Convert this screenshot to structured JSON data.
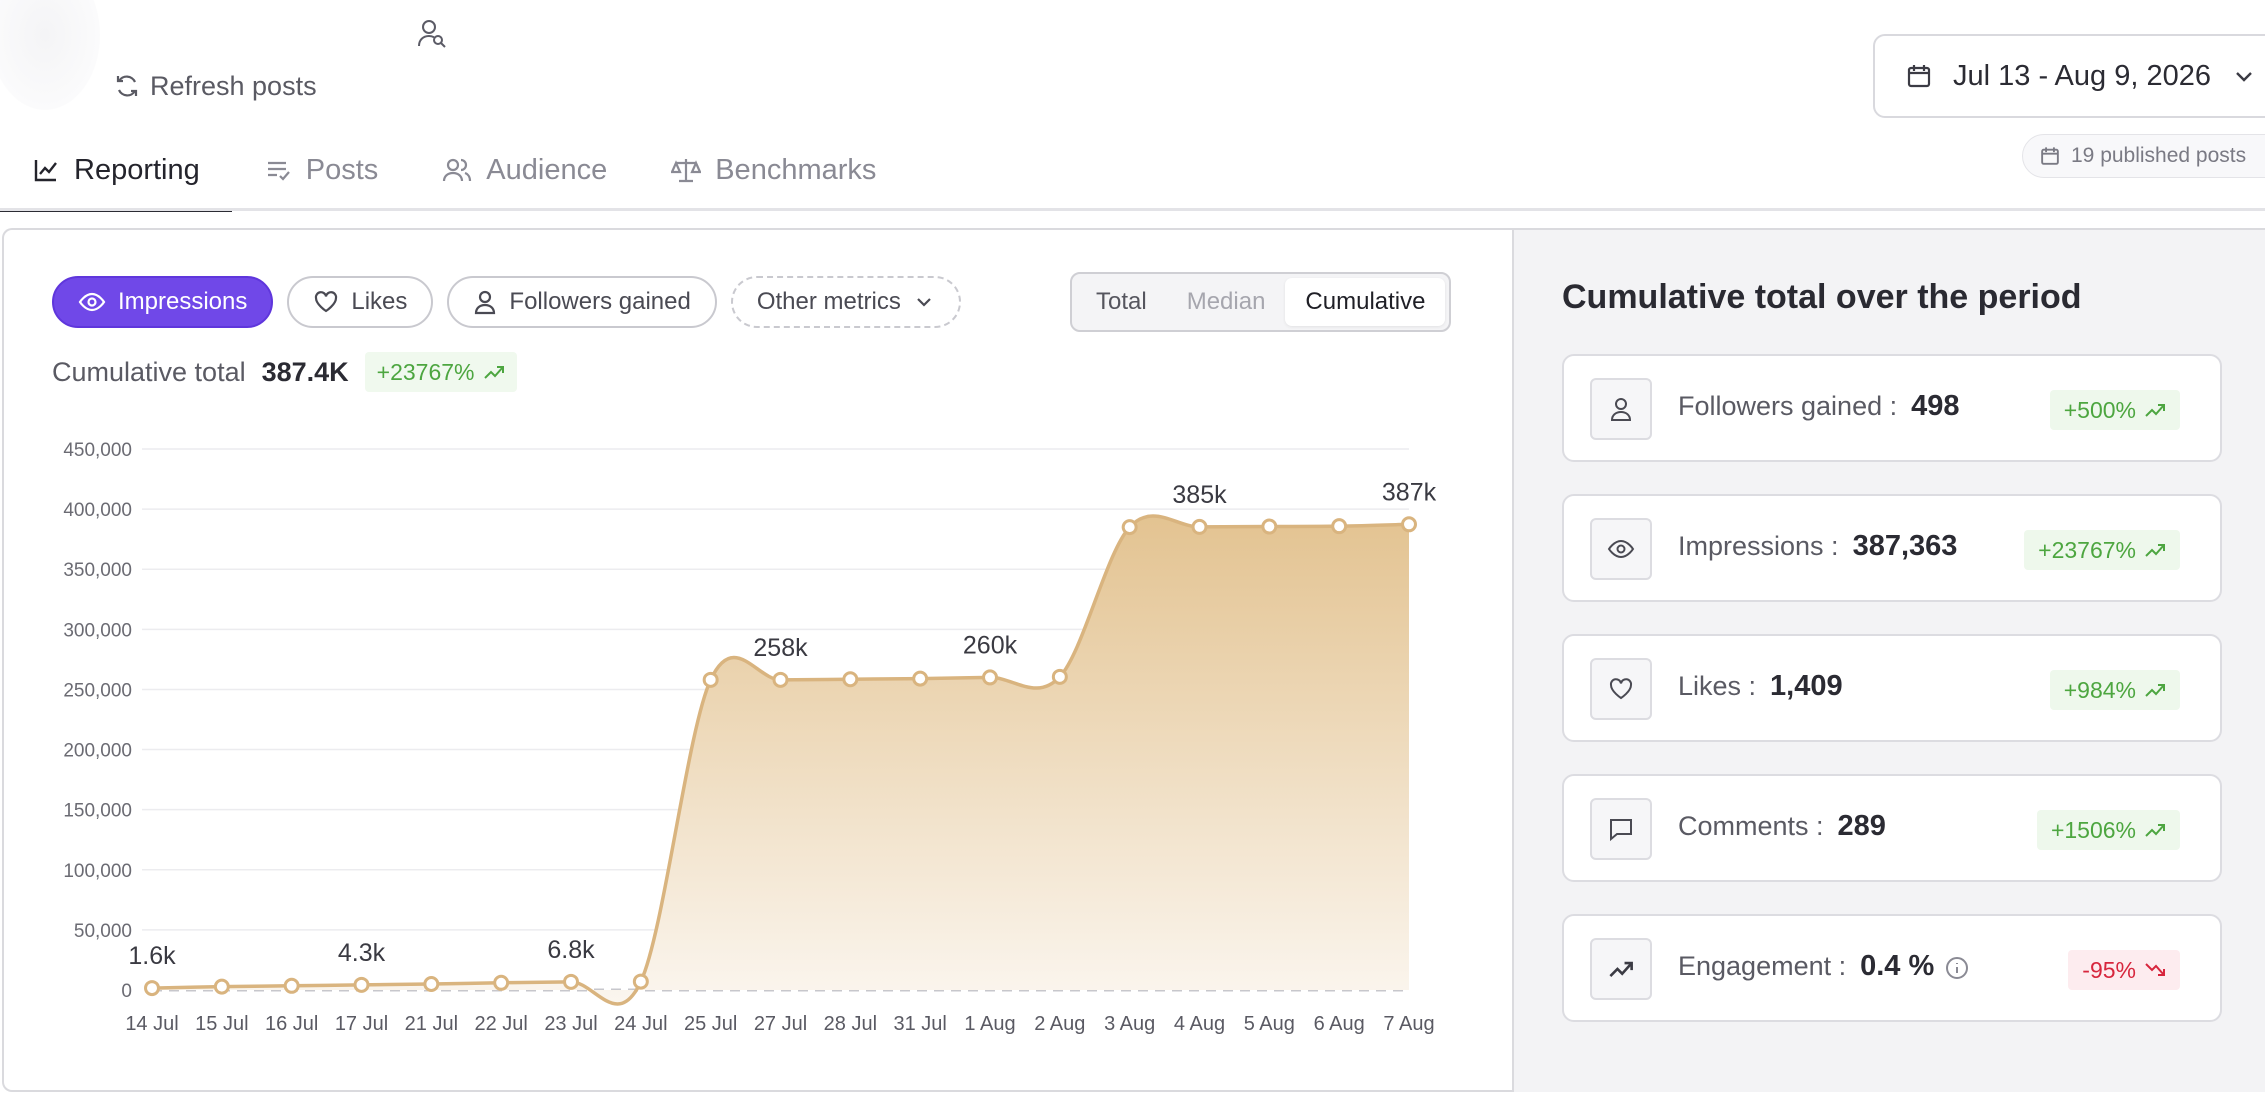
{
  "header": {
    "refresh_label": "Refresh posts",
    "date_range": "Jul 13 - Aug 9, 2026",
    "published_posts": "19 published posts"
  },
  "tabs": [
    {
      "label": "Reporting",
      "icon": "line-chart-icon",
      "active": true
    },
    {
      "label": "Posts",
      "icon": "list-check-icon",
      "active": false
    },
    {
      "label": "Audience",
      "icon": "users-icon",
      "active": false
    },
    {
      "label": "Benchmarks",
      "icon": "scale-icon",
      "active": false
    }
  ],
  "metrics": {
    "pills": [
      {
        "label": "Impressions",
        "icon": "eye-icon",
        "active": true
      },
      {
        "label": "Likes",
        "icon": "heart-icon",
        "active": false
      },
      {
        "label": "Followers gained",
        "icon": "user-icon",
        "active": false
      },
      {
        "label": "Other metrics",
        "icon": "chevron-down-icon",
        "active": false
      }
    ],
    "modes": [
      "Total",
      "Median",
      "Cumulative"
    ],
    "active_mode": "Cumulative"
  },
  "summary": {
    "label": "Cumulative total",
    "value": "387.4K",
    "delta": "+23767%"
  },
  "chart_data": {
    "type": "area",
    "categories": [
      "14 Jul",
      "15 Jul",
      "16 Jul",
      "17 Jul",
      "21 Jul",
      "22 Jul",
      "23 Jul",
      "24 Jul",
      "25 Jul",
      "27 Jul",
      "28 Jul",
      "31 Jul",
      "1 Aug",
      "2 Aug",
      "3 Aug",
      "4 Aug",
      "5 Aug",
      "6 Aug",
      "7 Aug"
    ],
    "values": [
      1600,
      2800,
      3500,
      4300,
      5000,
      6000,
      6800,
      7000,
      258000,
      258000,
      258500,
      259000,
      260000,
      260500,
      385000,
      385200,
      385500,
      385800,
      387363
    ],
    "point_labels": {
      "0": "1.6k",
      "3": "4.3k",
      "6": "6.8k",
      "9": "258k",
      "12": "260k",
      "15": "385k",
      "18": "387k"
    },
    "yticks": [
      0,
      50000,
      100000,
      150000,
      200000,
      250000,
      300000,
      350000,
      400000,
      450000
    ],
    "ytick_labels": [
      "0",
      "50,000",
      "100,000",
      "150,000",
      "200,000",
      "250,000",
      "300,000",
      "350,000",
      "400,000",
      "450,000"
    ],
    "ylim": [
      0,
      450000
    ],
    "grid": true,
    "colors": {
      "line": "#d9b47f",
      "fill_top": "#e3c391",
      "fill_bottom": "#fbf6ef",
      "point_fill": "#ffffff"
    }
  },
  "side": {
    "title": "Cumulative total over the period",
    "cards": [
      {
        "label": "Followers gained :",
        "value": "498",
        "delta": "+500%",
        "dir": "up",
        "icon": "user-icon"
      },
      {
        "label": "Impressions :",
        "value": "387,363",
        "delta": "+23767%",
        "dir": "up",
        "icon": "eye-icon"
      },
      {
        "label": "Likes :",
        "value": "1,409",
        "delta": "+984%",
        "dir": "up",
        "icon": "heart-icon"
      },
      {
        "label": "Comments :",
        "value": "289",
        "delta": "+1506%",
        "dir": "up",
        "icon": "comment-icon"
      },
      {
        "label": "Engagement :",
        "value": "0.4 %",
        "delta": "-95%",
        "dir": "down",
        "icon": "trend-up-icon"
      }
    ]
  }
}
